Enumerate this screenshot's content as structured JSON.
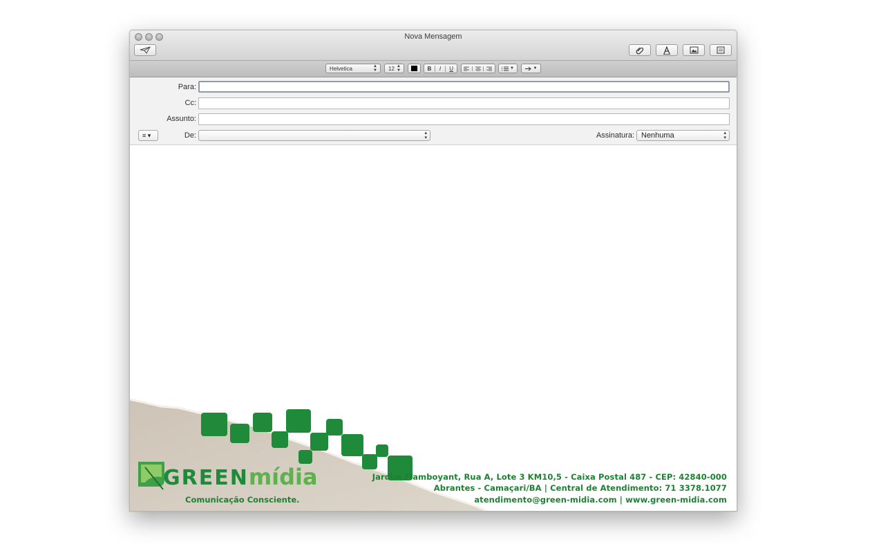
{
  "window": {
    "title": "Nova Mensagem"
  },
  "toolbar": {
    "send_icon": "paper-plane-icon",
    "attach_icon": "paperclip-icon",
    "fonts_icon": "fonts-a-icon",
    "photo_icon": "photo-browser-icon",
    "template_icon": "stationery-icon"
  },
  "format_bar": {
    "font": "Helvetica",
    "size": "12",
    "text_color": "#000000",
    "bold": "B",
    "italic": "I",
    "underline": "U"
  },
  "headers": {
    "to_label": "Para:",
    "cc_label": "Cc:",
    "subject_label": "Assunto:",
    "from_label": "De:",
    "signature_label": "Assinatura:",
    "signature_value": "Nenhuma",
    "to_value": "",
    "cc_value": "",
    "subject_value": "",
    "from_value": ""
  },
  "stationery": {
    "brand_green": "GREEN",
    "brand_midia": "mídia",
    "tagline": "Comunicação Consciente.",
    "address_line1": "Jardim Flamboyant, Rua A, Lote 3  KM10,5  - Caixa Postal 487 - CEP: 42840-000",
    "address_line2": "Abrantes - Camaçari/BA  |  Central de Atendimento: 71 3378.1077",
    "address_line3": "atendimento@green-midia.com   |   www.green-midia.com",
    "accent_color": "#1f8a3a"
  }
}
